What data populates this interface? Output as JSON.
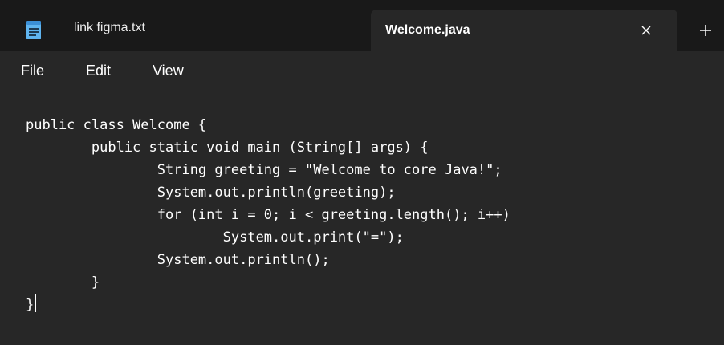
{
  "tabs": [
    {
      "label": "link figma.txt",
      "active": false
    },
    {
      "label": "Welcome.java",
      "active": true
    }
  ],
  "menu": {
    "file": "File",
    "edit": "Edit",
    "view": "View"
  },
  "icons": {
    "notepad": "notepad-icon",
    "close": "close-icon",
    "new_tab": "plus-icon"
  },
  "editor": {
    "lines": [
      "public class Welcome {",
      "        public static void main (String[] args) {",
      "                String greeting = \"Welcome to core Java!\";",
      "                System.out.println(greeting);",
      "                for (int i = 0; i < greeting.length(); i++)",
      "                        System.out.print(\"=\");",
      "                System.out.println();",
      "        }",
      "}"
    ]
  },
  "colors": {
    "tab_bar": "#191919",
    "active_tab": "#272727",
    "editor_background": "#272727",
    "text": "#ffffff",
    "notepad_icon": "#5fb4ef"
  }
}
